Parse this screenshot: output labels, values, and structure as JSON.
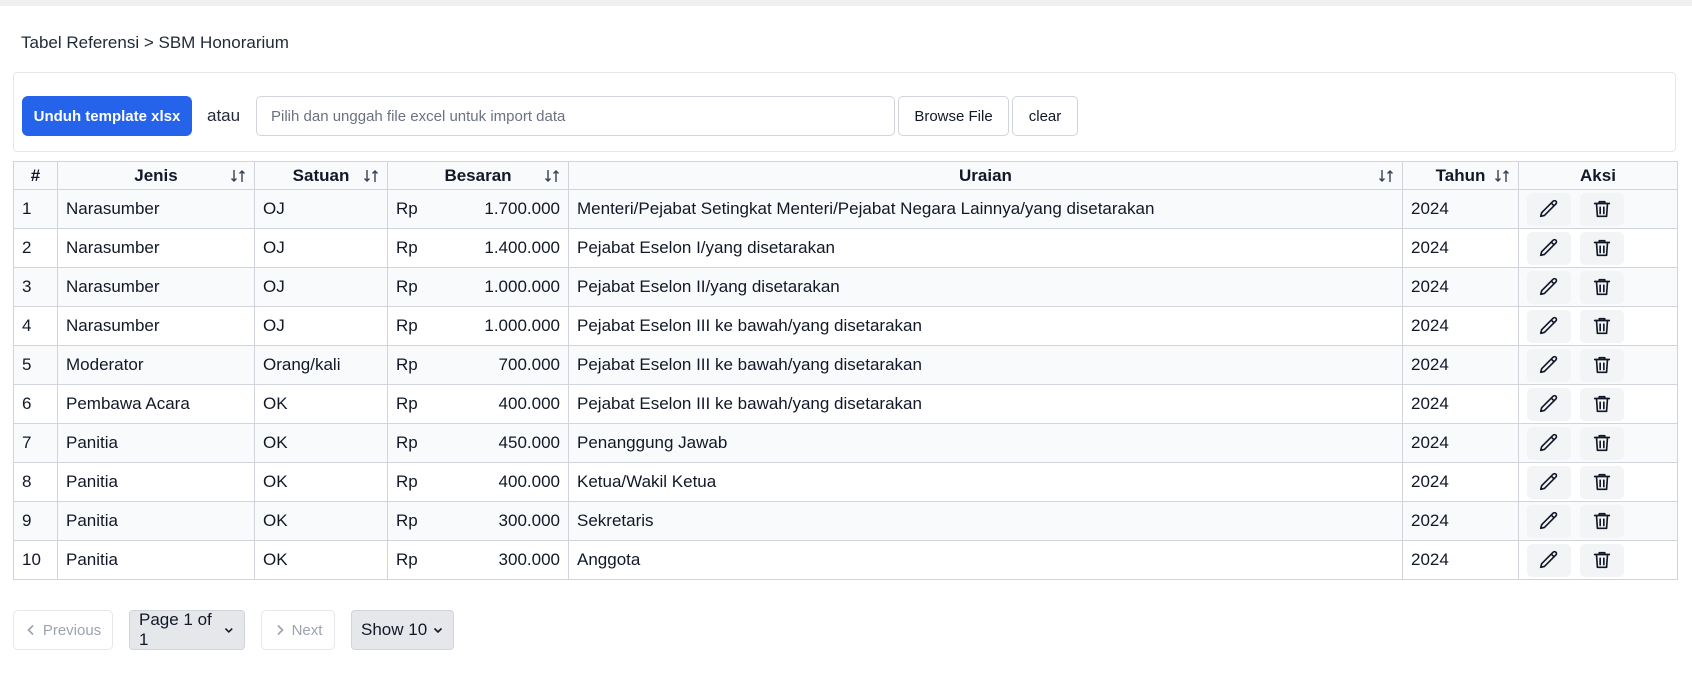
{
  "breadcrumb": {
    "parent": "Tabel Referensi",
    "separator": " > ",
    "current": "SBM Honorarium"
  },
  "import": {
    "download_label": "Unduh template xlsx",
    "or_label": "atau",
    "file_placeholder": "Pilih dan unggah file excel untuk import data",
    "browse_label": "Browse File",
    "clear_label": "clear"
  },
  "table": {
    "headers": {
      "num": "#",
      "jenis": "Jenis",
      "satuan": "Satuan",
      "besaran": "Besaran",
      "uraian": "Uraian",
      "tahun": "Tahun",
      "aksi": "Aksi"
    },
    "rows": [
      {
        "num": "1",
        "jenis": "Narasumber",
        "satuan": "OJ",
        "currency": "Rp",
        "besaran": "1.700.000",
        "uraian": "Menteri/Pejabat Setingkat Menteri/Pejabat Negara Lainnya/yang disetarakan",
        "tahun": "2024"
      },
      {
        "num": "2",
        "jenis": "Narasumber",
        "satuan": "OJ",
        "currency": "Rp",
        "besaran": "1.400.000",
        "uraian": "Pejabat Eselon I/yang disetarakan",
        "tahun": "2024"
      },
      {
        "num": "3",
        "jenis": "Narasumber",
        "satuan": "OJ",
        "currency": "Rp",
        "besaran": "1.000.000",
        "uraian": "Pejabat Eselon II/yang disetarakan",
        "tahun": "2024"
      },
      {
        "num": "4",
        "jenis": "Narasumber",
        "satuan": "OJ",
        "currency": "Rp",
        "besaran": "1.000.000",
        "uraian": "Pejabat Eselon III ke bawah/yang disetarakan",
        "tahun": "2024"
      },
      {
        "num": "5",
        "jenis": "Moderator",
        "satuan": "Orang/kali",
        "currency": "Rp",
        "besaran": "700.000",
        "uraian": "Pejabat Eselon III ke bawah/yang disetarakan",
        "tahun": "2024"
      },
      {
        "num": "6",
        "jenis": "Pembawa Acara",
        "satuan": "OK",
        "currency": "Rp",
        "besaran": "400.000",
        "uraian": "Pejabat Eselon III ke bawah/yang disetarakan",
        "tahun": "2024"
      },
      {
        "num": "7",
        "jenis": "Panitia",
        "satuan": "OK",
        "currency": "Rp",
        "besaran": "450.000",
        "uraian": "Penanggung Jawab",
        "tahun": "2024"
      },
      {
        "num": "8",
        "jenis": "Panitia",
        "satuan": "OK",
        "currency": "Rp",
        "besaran": "400.000",
        "uraian": "Ketua/Wakil Ketua",
        "tahun": "2024"
      },
      {
        "num": "9",
        "jenis": "Panitia",
        "satuan": "OK",
        "currency": "Rp",
        "besaran": "300.000",
        "uraian": "Sekretaris",
        "tahun": "2024"
      },
      {
        "num": "10",
        "jenis": "Panitia",
        "satuan": "OK",
        "currency": "Rp",
        "besaran": "300.000",
        "uraian": "Anggota",
        "tahun": "2024"
      }
    ],
    "action_icons": [
      "pencil-icon",
      "trash-icon"
    ]
  },
  "pagination": {
    "previous_label": "Previous",
    "next_label": "Next",
    "page_label": "Page 1 of 1",
    "show_label": "Show 10"
  },
  "colors": {
    "primary": "#2563eb",
    "border": "#d1d5db",
    "row_alt": "#f9fafb"
  }
}
